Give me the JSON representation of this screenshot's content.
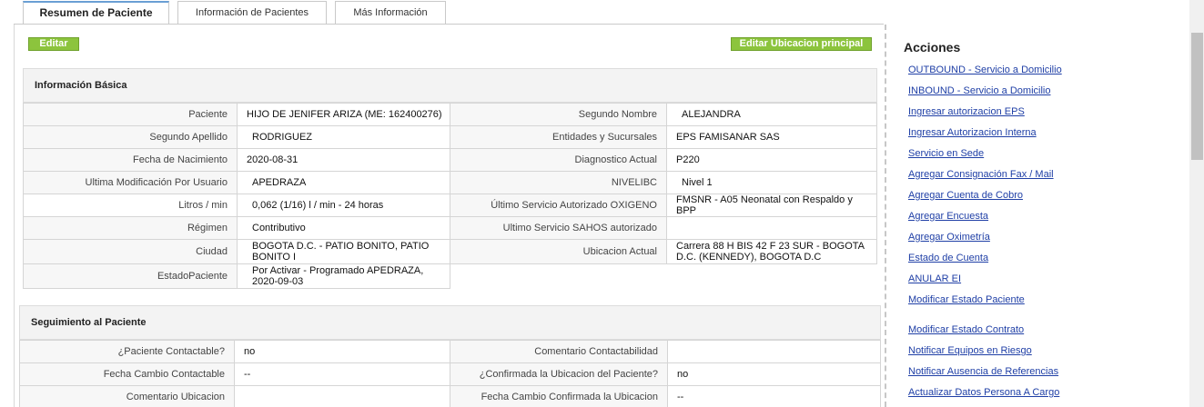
{
  "tabs": [
    "Resumen de Paciente",
    "Información de Pacientes",
    "Más Información"
  ],
  "buttons": {
    "editar": "Editar",
    "editar_ubicacion": "Editar Ubicacion principal"
  },
  "basic": {
    "title": "Información Básica",
    "left": [
      {
        "label": "Paciente",
        "value": "HIJO DE JENIFER ARIZA (ME: 162400276)"
      },
      {
        "label": "Segundo Apellido",
        "value": "RODRIGUEZ"
      },
      {
        "label": "Fecha de Nacimiento",
        "value": "2020-08-31"
      },
      {
        "label": "Ultima Modificación Por Usuario",
        "value": "APEDRAZA"
      },
      {
        "label": "Litros / min",
        "value": "0,062 (1/16) l / min - 24 horas"
      },
      {
        "label": "Régimen",
        "value": "Contributivo"
      },
      {
        "label": "Ciudad",
        "value": "BOGOTA D.C. - PATIO BONITO, PATIO BONITO I"
      },
      {
        "label": "EstadoPaciente",
        "value": "Por Activar - Programado APEDRAZA, 2020-09-03"
      }
    ],
    "right": [
      {
        "label": "Segundo Nombre",
        "value": "ALEJANDRA"
      },
      {
        "label": "Entidades y Sucursales",
        "value": "EPS FAMISANAR SAS"
      },
      {
        "label": "Diagnostico Actual",
        "value": "P220"
      },
      {
        "label": "NIVELIBC",
        "value": "Nivel 1"
      },
      {
        "label": "Último Servicio Autorizado OXIGENO",
        "value": "FMSNR - A05 Neonatal con Respaldo y BPP"
      },
      {
        "label": "Ultimo Servicio SAHOS autorizado",
        "value": ""
      },
      {
        "label": "Ubicacion Actual",
        "value": "Carrera 88 H BIS 42 F 23 SUR - BOGOTA D.C. (KENNEDY), BOGOTA D.C"
      }
    ]
  },
  "seguimiento": {
    "title": "Seguimiento al Paciente",
    "rows": [
      {
        "l1": "¿Paciente Contactable?",
        "v1": "no",
        "l2": "Comentario Contactabilidad",
        "v2": ""
      },
      {
        "l1": "Fecha Cambio Contactable",
        "v1": "--",
        "l2": "¿Confirmada la Ubicacion del Paciente?",
        "v2": "no"
      },
      {
        "l1": "Comentario Ubicacion",
        "v1": "",
        "l2": "Fecha Cambio Confirmada la Ubicacion",
        "v2": "--"
      }
    ]
  },
  "acciones": {
    "title": "Acciones",
    "links": [
      "OUTBOUND - Servicio a Domicilio",
      "INBOUND - Servicio a Domicilio",
      "Ingresar autorizacion EPS",
      "Ingresar Autorizacion Interna",
      "Servicio en Sede",
      "Agregar Consignación Fax / Mail",
      "Agregar Cuenta de Cobro",
      "Agregar Encuesta",
      "Agregar Oximetría",
      "Estado de Cuenta",
      "ANULAR EI",
      "Modificar Estado Paciente",
      "Modificar Estado Contrato",
      "Notificar Equipos en Riesgo",
      "Notificar Ausencia de Referencias",
      "Actualizar Datos Persona A Cargo"
    ]
  },
  "colors": {
    "highlight": "#fbf31a",
    "button": "#8cc43d",
    "link": "#1f3fa6"
  }
}
